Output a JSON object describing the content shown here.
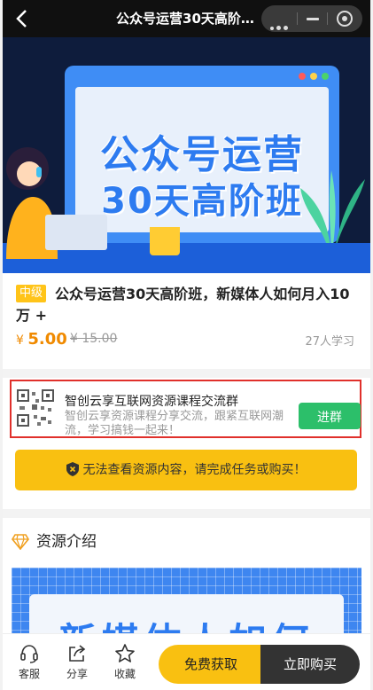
{
  "header": {
    "title": "公众号运营30天高阶班..."
  },
  "banner": {
    "line1": "公众号运营",
    "line2": "30天高阶班"
  },
  "product": {
    "level": "中级",
    "name": "公众号运营30天高阶班，新媒体人如何月入10万 +",
    "currency": "¥",
    "price": "5.00",
    "original_price": "¥ 15.00",
    "learners": "27人学习"
  },
  "group": {
    "title": "智创云享互联网资源课程交流群",
    "description": "智创云享资源课程分享交流，跟紧互联网潮流，学习搞钱一起来！",
    "join_label": "进群"
  },
  "notice": {
    "text": "无法查看资源内容，请完成任务或购买！"
  },
  "resource": {
    "heading": "资源介绍",
    "preview_text": "新媒体人如何"
  },
  "bottom_bar": {
    "service": "客服",
    "share": "分享",
    "favorite": "收藏",
    "free_label": "免费获取",
    "buy_label": "立即购买"
  },
  "colors": {
    "accent": "#f9c011",
    "price": "#f08a00",
    "join": "#2cbf6a",
    "highlight": "#e0302b"
  }
}
